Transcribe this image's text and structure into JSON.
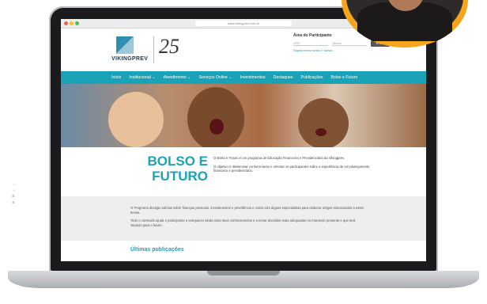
{
  "browser": {
    "url": "www.vikingprev.com.br"
  },
  "header": {
    "logo_text": "VIKINGPREV",
    "anniversary": "25",
    "participant_area": {
      "title": "Área do Participante",
      "cpf_placeholder": "CPF",
      "password_placeholder": "Senha",
      "enter_button": "Entrar",
      "links": "Esqueci minha senha   1º acesso"
    }
  },
  "nav": {
    "items": [
      "Início",
      "Institucional ⌄",
      "Atendimento ⌄",
      "Serviços Online ⌄",
      "Investimentos",
      "Destaques",
      "Publicações",
      "Bolso e Futuro"
    ]
  },
  "bolso": {
    "title_line1": "BOLSO E",
    "title_line2": "FUTURO",
    "paragraph1": "O Bolso e Futuro é um programa de Educação Financeira e Previdenciária da Vikingprev.",
    "paragraph2": "O objetivo é disseminar conhecimento e orientar os participantes sobre a importância de um planejamento financeiro e previdenciário."
  },
  "band": {
    "paragraph1": "O Programa divulga notícias sobre finanças pessoais, investimentos e previdência e conta com alguns especialistas para elaborar artigos relacionados a estes temas.",
    "paragraph2": "Todo o conteúdo ajuda o participante a enriquecer ainda mais seus conhecimentos e a tomar decisões mais adequadas no momento presente e que terá impacto para o futuro."
  },
  "ultimas": {
    "title": "Últimas publicações"
  },
  "colors": {
    "accent": "#1aa3b7",
    "photo_ring": "#f3a51d"
  }
}
